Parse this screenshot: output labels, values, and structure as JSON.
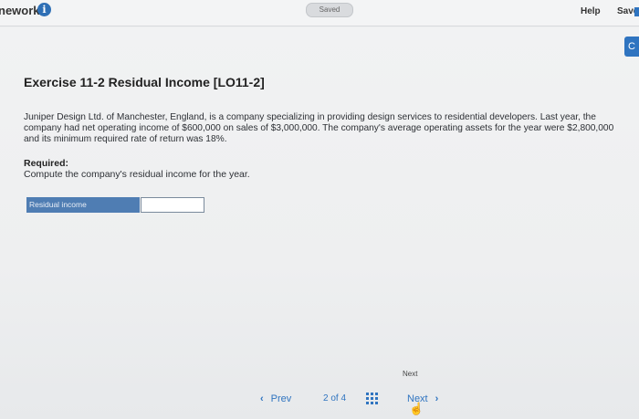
{
  "topbar": {
    "homework_label": "nework",
    "saved_label": "Saved",
    "help_label": "Help",
    "save_label": "Save"
  },
  "side_tab_label": "C",
  "exercise": {
    "title": "Exercise 11-2 Residual Income [LO11-2]",
    "problem": "Juniper Design Ltd. of Manchester, England, is a company specializing in providing design services to residential developers. Last year, the company had net operating income of $600,000 on sales of $3,000,000. The company's average operating assets for the year were $2,800,000 and its minimum required rate of return was 18%.",
    "required_label": "Required:",
    "required_text": "Compute the company's residual income for the year.",
    "answer_label": "Residual income",
    "answer_value": ""
  },
  "navigation": {
    "next_tooltip": "Next",
    "prev_label": "Prev",
    "current_page": "2",
    "of_label": "of",
    "total_pages": "4",
    "next_label": "Next"
  },
  "colors": {
    "accent": "#2f74c0",
    "answer_label_bg": "#4f7db3"
  }
}
